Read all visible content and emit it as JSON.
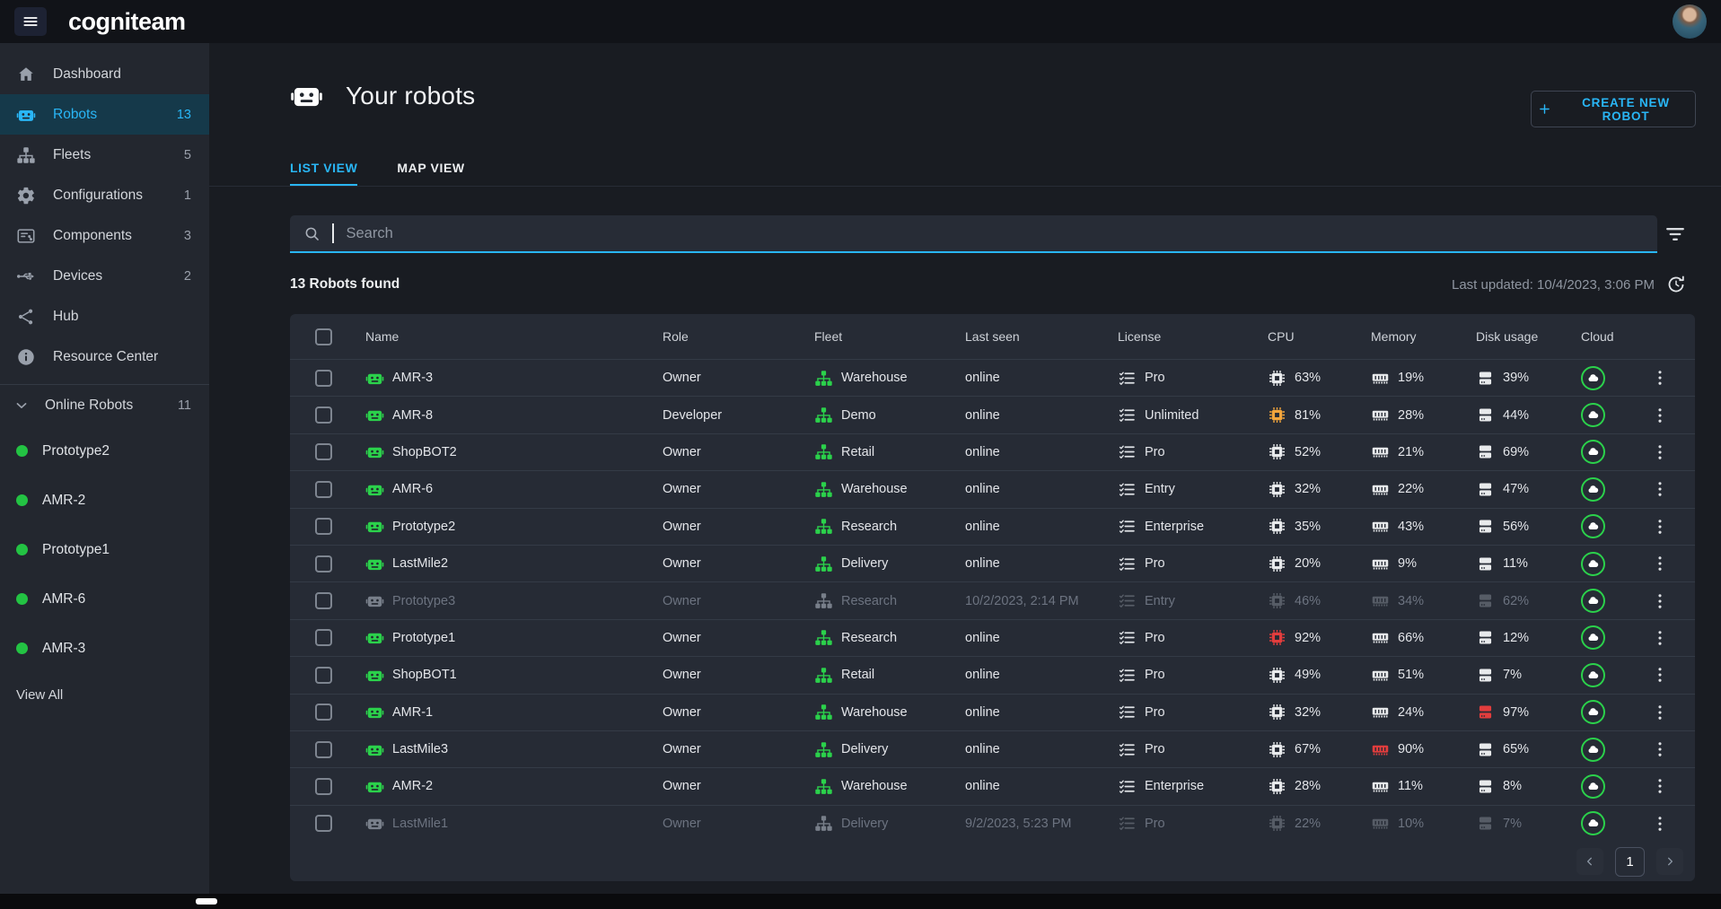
{
  "topbar": {
    "brand": "cogniteam"
  },
  "sidebar": {
    "items": [
      {
        "label": "Dashboard",
        "icon": "home",
        "count": "",
        "active": false
      },
      {
        "label": "Robots",
        "icon": "robot",
        "count": "13",
        "active": true
      },
      {
        "label": "Fleets",
        "icon": "fleet",
        "count": "5",
        "active": false
      },
      {
        "label": "Configurations",
        "icon": "gear",
        "count": "1",
        "active": false
      },
      {
        "label": "Components",
        "icon": "components",
        "count": "3",
        "active": false
      },
      {
        "label": "Devices",
        "icon": "devices",
        "count": "2",
        "active": false
      },
      {
        "label": "Hub",
        "icon": "share",
        "count": "",
        "active": false
      },
      {
        "label": "Resource Center",
        "icon": "info",
        "count": "",
        "active": false
      }
    ],
    "online_robots": {
      "label": "Online Robots",
      "count": "11",
      "robots": [
        "Prototype2",
        "AMR-2",
        "Prototype1",
        "AMR-6",
        "AMR-3"
      ],
      "view_all": "View All"
    }
  },
  "header": {
    "title": "Your robots",
    "create_button": "CREATE NEW ROBOT"
  },
  "tabs": [
    {
      "label": "LIST VIEW",
      "active": true
    },
    {
      "label": "MAP VIEW",
      "active": false
    }
  ],
  "search": {
    "placeholder": "Search"
  },
  "summary": {
    "found": "13 Robots found",
    "last_updated": "Last updated: 10/4/2023, 3:06 PM"
  },
  "table": {
    "columns": [
      "Name",
      "Role",
      "Fleet",
      "Last seen",
      "License",
      "CPU",
      "Memory",
      "Disk usage",
      "Cloud"
    ],
    "rows": [
      {
        "name": "AMR-3",
        "role": "Owner",
        "fleet": "Warehouse",
        "last_seen": "online",
        "license": "Pro",
        "cpu": "63%",
        "memory": "19%",
        "disk": "39%",
        "status": "online",
        "cpu_state": "normal",
        "mem_state": "normal",
        "disk_state": "normal"
      },
      {
        "name": "AMR-8",
        "role": "Developer",
        "fleet": "Demo",
        "last_seen": "online",
        "license": "Unlimited",
        "cpu": "81%",
        "memory": "28%",
        "disk": "44%",
        "status": "online",
        "cpu_state": "warn",
        "mem_state": "normal",
        "disk_state": "normal"
      },
      {
        "name": "ShopBOT2",
        "role": "Owner",
        "fleet": "Retail",
        "last_seen": "online",
        "license": "Pro",
        "cpu": "52%",
        "memory": "21%",
        "disk": "69%",
        "status": "online",
        "cpu_state": "normal",
        "mem_state": "normal",
        "disk_state": "normal"
      },
      {
        "name": "AMR-6",
        "role": "Owner",
        "fleet": "Warehouse",
        "last_seen": "online",
        "license": "Entry",
        "cpu": "32%",
        "memory": "22%",
        "disk": "47%",
        "status": "online",
        "cpu_state": "normal",
        "mem_state": "normal",
        "disk_state": "normal"
      },
      {
        "name": "Prototype2",
        "role": "Owner",
        "fleet": "Research",
        "last_seen": "online",
        "license": "Enterprise",
        "cpu": "35%",
        "memory": "43%",
        "disk": "56%",
        "status": "online",
        "cpu_state": "normal",
        "mem_state": "normal",
        "disk_state": "normal"
      },
      {
        "name": "LastMile2",
        "role": "Owner",
        "fleet": "Delivery",
        "last_seen": "online",
        "license": "Pro",
        "cpu": "20%",
        "memory": "9%",
        "disk": "11%",
        "status": "online",
        "cpu_state": "normal",
        "mem_state": "normal",
        "disk_state": "normal"
      },
      {
        "name": "Prototype3",
        "role": "Owner",
        "fleet": "Research",
        "last_seen": "10/2/2023, 2:14 PM",
        "license": "Entry",
        "cpu": "46%",
        "memory": "34%",
        "disk": "62%",
        "status": "offline",
        "cpu_state": "normal",
        "mem_state": "normal",
        "disk_state": "normal"
      },
      {
        "name": "Prototype1",
        "role": "Owner",
        "fleet": "Research",
        "last_seen": "online",
        "license": "Pro",
        "cpu": "92%",
        "memory": "66%",
        "disk": "12%",
        "status": "online",
        "cpu_state": "critical",
        "mem_state": "normal",
        "disk_state": "normal"
      },
      {
        "name": "ShopBOT1",
        "role": "Owner",
        "fleet": "Retail",
        "last_seen": "online",
        "license": "Pro",
        "cpu": "49%",
        "memory": "51%",
        "disk": "7%",
        "status": "online",
        "cpu_state": "normal",
        "mem_state": "normal",
        "disk_state": "normal"
      },
      {
        "name": "AMR-1",
        "role": "Owner",
        "fleet": "Warehouse",
        "last_seen": "online",
        "license": "Pro",
        "cpu": "32%",
        "memory": "24%",
        "disk": "97%",
        "status": "online",
        "cpu_state": "normal",
        "mem_state": "normal",
        "disk_state": "critical"
      },
      {
        "name": "LastMile3",
        "role": "Owner",
        "fleet": "Delivery",
        "last_seen": "online",
        "license": "Pro",
        "cpu": "67%",
        "memory": "90%",
        "disk": "65%",
        "status": "online",
        "cpu_state": "normal",
        "mem_state": "critical",
        "disk_state": "normal"
      },
      {
        "name": "AMR-2",
        "role": "Owner",
        "fleet": "Warehouse",
        "last_seen": "online",
        "license": "Enterprise",
        "cpu": "28%",
        "memory": "11%",
        "disk": "8%",
        "status": "online",
        "cpu_state": "normal",
        "mem_state": "normal",
        "disk_state": "normal"
      },
      {
        "name": "LastMile1",
        "role": "Owner",
        "fleet": "Delivery",
        "last_seen": "9/2/2023, 5:23 PM",
        "license": "Pro",
        "cpu": "22%",
        "memory": "10%",
        "disk": "7%",
        "status": "offline",
        "cpu_state": "normal",
        "mem_state": "normal",
        "disk_state": "normal"
      }
    ]
  },
  "pagination": {
    "current": "1"
  },
  "colors": {
    "accent": "#29b6f6",
    "green": "#2bd14b",
    "warn": "#f0a43c",
    "critical": "#e23d3d",
    "card_bg": "#262b35",
    "sidebar_bg": "#23272f",
    "topbar_bg": "#111318"
  }
}
